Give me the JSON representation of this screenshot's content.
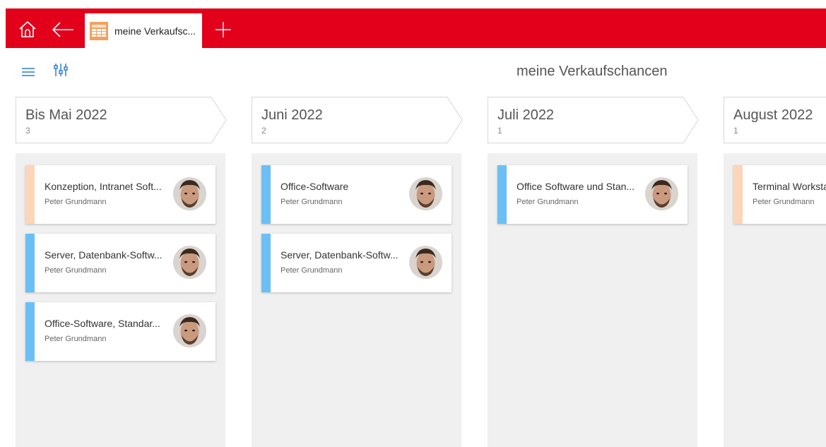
{
  "tab": {
    "label": "meine Verkaufsc..."
  },
  "toolbar": {
    "title": "meine Verkaufschancen"
  },
  "colors": {
    "brand": "#e2001a",
    "stripe_orange": "#fcd5bb",
    "stripe_blue": "#6ac0f5",
    "column_bg": "#f0f0f0"
  },
  "icons": {
    "home": "home-icon",
    "back": "arrow-left-icon",
    "tab": "table-icon",
    "add": "plus-icon",
    "menu": "hamburger-menu-icon",
    "filter": "sliders-icon",
    "avatar": "user-avatar"
  },
  "columns": [
    {
      "title": "Bis Mai 2022",
      "count": "3",
      "cards": [
        {
          "title": "Konzeption, Intranet Soft...",
          "owner": "Peter Grundmann",
          "stripe": "#fcd5bb"
        },
        {
          "title": "Server, Datenbank-Softw...",
          "owner": "Peter Grundmann",
          "stripe": "#6ac0f5"
        },
        {
          "title": "Office-Software, Standar...",
          "owner": "Peter Grundmann",
          "stripe": "#6ac0f5"
        }
      ]
    },
    {
      "title": "Juni 2022",
      "count": "2",
      "cards": [
        {
          "title": "Office-Software",
          "owner": "Peter Grundmann",
          "stripe": "#6ac0f5"
        },
        {
          "title": "Server, Datenbank-Softw...",
          "owner": "Peter Grundmann",
          "stripe": "#6ac0f5"
        }
      ]
    },
    {
      "title": "Juli 2022",
      "count": "1",
      "cards": [
        {
          "title": "Office Software und Stan...",
          "owner": "Peter Grundmann",
          "stripe": "#6ac0f5"
        }
      ]
    },
    {
      "title": "August 2022",
      "count": "1",
      "cards": [
        {
          "title": "Terminal Workstation",
          "owner": "Peter Grundmann",
          "stripe": "#fcd5bb"
        }
      ]
    }
  ]
}
